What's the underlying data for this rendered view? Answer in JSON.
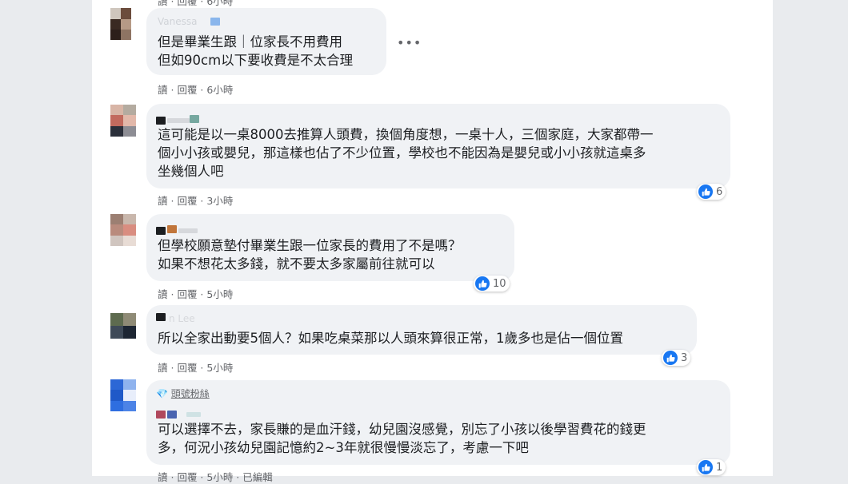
{
  "comments": [
    {
      "text": "但是畢業生跟｜位家長不用費用\n但如90cm以下要收費是不太合理",
      "actions": {
        "read": "讀",
        "reply": "回覆",
        "time": "6小時"
      },
      "likes": null
    },
    {
      "text": "這可能是以一桌8000去推算人頭費，換個角度想，一桌十人，三個家庭，大家都帶一\n個小小孩或嬰兒，那這樣也佔了不少位置，學校也不能因為是嬰兒或小小孩就這桌多\n坐幾個人吧",
      "actions": {
        "read": "讀",
        "reply": "回覆",
        "time": "3小時"
      },
      "likes": "6"
    },
    {
      "text": "但學校願意墊付畢業生跟一位家長的費用了不是嗎？\n如果不想花太多錢，就不要太多家屬前往就可以",
      "actions": {
        "read": "讀",
        "reply": "回覆",
        "time": "5小時"
      },
      "likes": "10"
    },
    {
      "text": "所以全家出動要5個人？如果吃桌菜那以人頭來算很正常，1歲多也是佔一個位置",
      "actions": {
        "read": "讀",
        "reply": "回覆",
        "time": "5小時"
      },
      "likes": "3"
    },
    {
      "badge": "頭號粉絲",
      "text": "可以選擇不去，家長賺的是血汗錢，幼兒園沒感覺，別忘了小孩以後學習費花的錢更\n多，何況小孩幼兒園記憶約2~3年就很慢慢淡忘了，考慮一下吧",
      "actions": {
        "read": "讀",
        "reply": "回覆",
        "time": "5小時",
        "extra": "已編輯"
      },
      "likes": "1"
    }
  ],
  "ui": {
    "separator": " · ",
    "more_icon": "more-dots-icon",
    "like_icon": "thumbs-up-icon",
    "accent": "#1877f2"
  }
}
